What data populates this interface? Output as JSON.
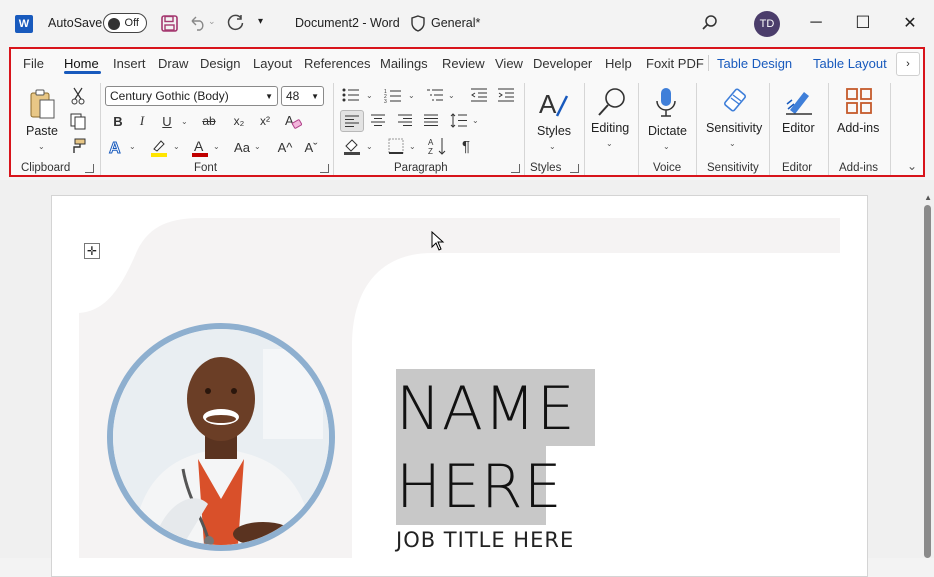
{
  "titlebar": {
    "app_logo": "W",
    "autosave_label": "AutoSave",
    "autosave_state": "Off",
    "document_title": "Document2 - Word",
    "sensitivity_label": "General*",
    "avatar_initials": "TD",
    "minimize": "─",
    "maximize": "☐",
    "close": "✕"
  },
  "ribbon": {
    "tabs": [
      {
        "label": "File"
      },
      {
        "label": "Home",
        "active": true
      },
      {
        "label": "Insert"
      },
      {
        "label": "Draw"
      },
      {
        "label": "Design"
      },
      {
        "label": "Layout"
      },
      {
        "label": "References"
      },
      {
        "label": "Mailings"
      },
      {
        "label": "Review"
      },
      {
        "label": "View"
      },
      {
        "label": "Developer"
      },
      {
        "label": "Help"
      },
      {
        "label": "Foxit PDF"
      },
      {
        "label": "Table Design"
      },
      {
        "label": "Table Layout"
      }
    ],
    "clipboard": {
      "paste": "Paste",
      "group": "Clipboard"
    },
    "font": {
      "family": "Century Gothic (Body)",
      "size": "48",
      "bold": "B",
      "italic": "I",
      "underline": "U",
      "strike": "ab",
      "subscript": "x₂",
      "superscript": "x²",
      "change_case": "Aa",
      "grow": "A^",
      "shrink": "Aˇ",
      "group": "Font"
    },
    "paragraph": {
      "group": "Paragraph"
    },
    "styles": {
      "label": "Styles",
      "group": "Styles"
    },
    "editing": {
      "label": "Editing"
    },
    "voice": {
      "label": "Dictate",
      "group": "Voice"
    },
    "sensitivity": {
      "label": "Sensitivity",
      "group": "Sensitivity"
    },
    "editor": {
      "label": "Editor",
      "group": "Editor"
    },
    "addins": {
      "label": "Add-ins",
      "group": "Add-ins"
    }
  },
  "document": {
    "name_line1": "NAME",
    "name_line2": "HERE",
    "job_title": "JOB TITLE HERE"
  },
  "colors": {
    "accent": "#185abd",
    "highlight_border": "#d8141b",
    "photo_ring": "#8eafcf",
    "font_color_bar": "#c00000",
    "highlight_bar": "#ffe500"
  }
}
